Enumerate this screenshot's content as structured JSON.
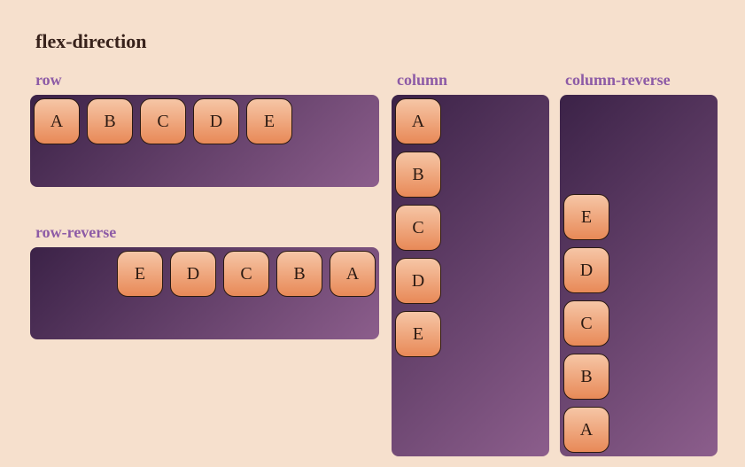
{
  "title": "flex-direction",
  "sections": {
    "row": {
      "label": "row",
      "items": [
        "A",
        "B",
        "C",
        "D",
        "E"
      ]
    },
    "row_reverse": {
      "label": "row-reverse",
      "items": [
        "A",
        "B",
        "C",
        "D",
        "E"
      ]
    },
    "column": {
      "label": "column",
      "items": [
        "A",
        "B",
        "C",
        "D",
        "E"
      ]
    },
    "column_reverse": {
      "label": "column-reverse",
      "items": [
        "A",
        "B",
        "C",
        "D",
        "E"
      ]
    }
  },
  "colors": {
    "background": "#f6e0cd",
    "container_gradient_from": "#3b2247",
    "container_gradient_to": "#8c5e8c",
    "item_gradient_from": "#f6c6a6",
    "item_gradient_to": "#e88957",
    "label_color": "#8d5ba6"
  }
}
